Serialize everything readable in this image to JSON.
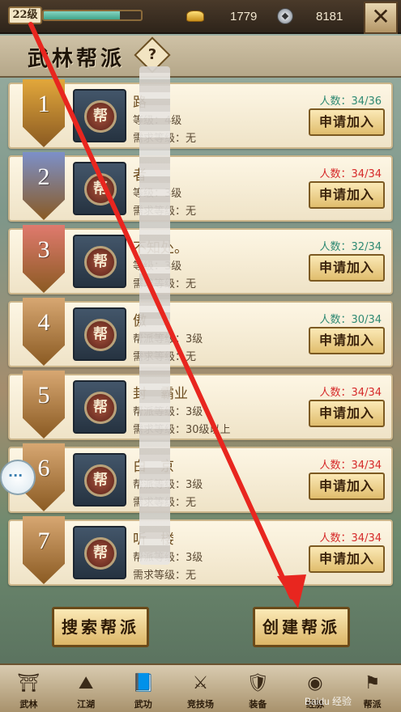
{
  "top": {
    "level": "22级",
    "exp_progress": 0.78,
    "gold": "1779",
    "silver": "8181",
    "close_glyph": "✕"
  },
  "header": {
    "title": "武林帮派",
    "help": "?"
  },
  "emblem_char": "帮",
  "rows": [
    {
      "rank": "1",
      "name": "路",
      "level": "等级：4级",
      "req": "需求等级：无",
      "members": "人数：34/36",
      "status": "ok",
      "apply": "申请加入",
      "banner": "#e2a73b"
    },
    {
      "rank": "2",
      "name": "者",
      "level": "等级：3级",
      "req": "需求等级：无",
      "members": "人数：34/34",
      "status": "full",
      "apply": "申请加入",
      "banner": "#7c90c9"
    },
    {
      "rank": "3",
      "name": "不知处。",
      "level": "等级：3级",
      "req": "需求等级：无",
      "members": "人数：32/34",
      "status": "ok",
      "apply": "申请加入",
      "banner": "#e07a6e"
    },
    {
      "rank": "4",
      "name": "傲",
      "level": "帮派等级：3级",
      "req": "需求等级：无",
      "members": "人数：30/34",
      "status": "ok",
      "apply": "申请加入",
      "banner": "#d7a772"
    },
    {
      "rank": "5",
      "name": "封　霸业",
      "level": "帮派等级：3级",
      "req": "需求等级：30级以上",
      "members": "人数：34/34",
      "status": "full",
      "apply": "申请加入",
      "banner": "#d7a772"
    },
    {
      "rank": "6",
      "name": "白　京",
      "level": "帮派等级：3级",
      "req": "需求等级：无",
      "members": "人数：34/34",
      "status": "full",
      "apply": "申请加入",
      "banner": "#d7a772"
    },
    {
      "rank": "7",
      "name": "听　楼",
      "level": "帮派等级：3级",
      "req": "需求等级：无",
      "members": "人数：34/34",
      "status": "full",
      "apply": "申请加入",
      "banner": "#d7a772"
    }
  ],
  "actions": {
    "search": "搜索帮派",
    "create": "创建帮派"
  },
  "nav": [
    {
      "label": "武林",
      "icon": "pagoda-icon",
      "glyph": "⛩"
    },
    {
      "label": "江湖",
      "icon": "straw-hat-icon",
      "glyph": "⛰"
    },
    {
      "label": "武功",
      "icon": "book-icon",
      "glyph": "📘"
    },
    {
      "label": "竞技场",
      "icon": "crossed-swords-icon",
      "glyph": "⚔"
    },
    {
      "label": "装备",
      "icon": "armor-icon",
      "glyph": "🛡"
    },
    {
      "label": "经脉",
      "icon": "orb-icon",
      "glyph": "◉"
    },
    {
      "label": "帮派",
      "icon": "guild-icon",
      "glyph": "⚑"
    }
  ],
  "watermark": "Baidu 经验"
}
